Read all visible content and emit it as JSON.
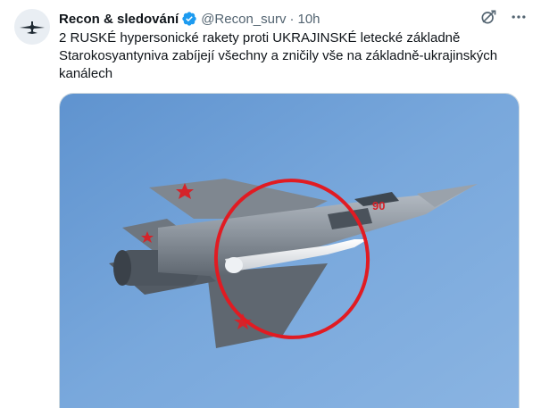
{
  "tweet": {
    "author": {
      "display_name": "Recon & sledování",
      "handle": "@Recon_surv",
      "verified": true,
      "avatar_icon": "drone-avatar-icon"
    },
    "separator": "·",
    "timestamp": "10h",
    "text_lines": [
      "2 RUSKÉ hypersonické rakety proti UKRAJINSKÉ letecké základně",
      "Starokosyantyniva zabíjejí všechny a zničily vše na základně-ukrajinských",
      "kanálech"
    ],
    "media": {
      "aircraft_tail_number": "90",
      "sky_color": "#6f9fd6",
      "highlight_circle_color": "#e11b22"
    }
  },
  "actions": {
    "grok_icon": "grok-icon",
    "more_icon": "more-dots-icon"
  },
  "colors": {
    "verified_badge": "#1d9bf0",
    "secondary_text": "#536471"
  }
}
